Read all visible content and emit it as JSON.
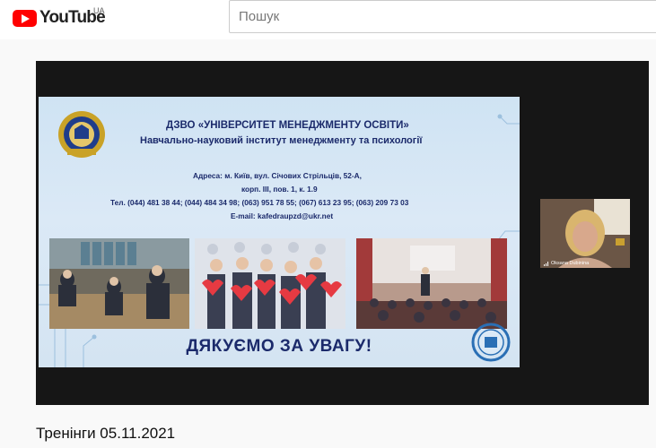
{
  "header": {
    "logo_text": "YouTube",
    "region": "UA",
    "search_placeholder": "Пошук"
  },
  "slide": {
    "line1": "ДЗВО «УНІВЕРСИТЕТ МЕНЕДЖМЕНТУ ОСВІТИ»",
    "line2": "Навчально-науковий інститут менеджменту та психології",
    "address1": "Адреса: м. Київ, вул. Січових Стрільців, 52-А,",
    "address2": "корп. ІІІ, пов. 1, к. 1.9",
    "phones": "Тел. (044) 481 38 44; (044) 484 34 98; (063) 951 78 55; (067) 613 23 95; (063) 209 73 03",
    "email": "E-mail: kafedraupzd@ukr.net",
    "thanks": "ДЯКУЄМО ЗА УВАГУ!"
  },
  "participant": {
    "name": "Oksana Dubinina"
  },
  "video": {
    "title": "Тренінги 05.11.2021"
  },
  "colors": {
    "brand_red": "#ff0000",
    "slide_text": "#1b2a6b",
    "player_bg": "#161616"
  }
}
